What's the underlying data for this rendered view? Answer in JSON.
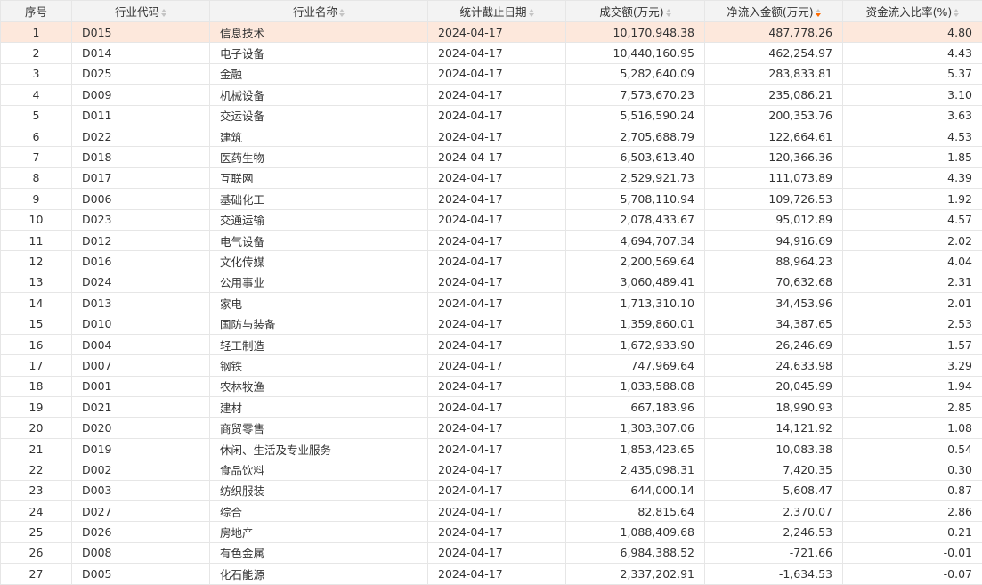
{
  "table": {
    "headers": [
      "序号",
      "行业代码",
      "行业名称",
      "统计截止日期",
      "成交额(万元)",
      "净流入金额(万元)",
      "资金流入比率(%)"
    ],
    "sort_active_color": "#ff6a00",
    "highlight_row_color": "#fde8dc",
    "rows": [
      [
        "1",
        "D015",
        "信息技术",
        "2024-04-17",
        "10,170,948.38",
        "487,778.26",
        "4.80"
      ],
      [
        "2",
        "D014",
        "电子设备",
        "2024-04-17",
        "10,440,160.95",
        "462,254.97",
        "4.43"
      ],
      [
        "3",
        "D025",
        "金融",
        "2024-04-17",
        "5,282,640.09",
        "283,833.81",
        "5.37"
      ],
      [
        "4",
        "D009",
        "机械设备",
        "2024-04-17",
        "7,573,670.23",
        "235,086.21",
        "3.10"
      ],
      [
        "5",
        "D011",
        "交运设备",
        "2024-04-17",
        "5,516,590.24",
        "200,353.76",
        "3.63"
      ],
      [
        "6",
        "D022",
        "建筑",
        "2024-04-17",
        "2,705,688.79",
        "122,664.61",
        "4.53"
      ],
      [
        "7",
        "D018",
        "医药生物",
        "2024-04-17",
        "6,503,613.40",
        "120,366.36",
        "1.85"
      ],
      [
        "8",
        "D017",
        "互联网",
        "2024-04-17",
        "2,529,921.73",
        "111,073.89",
        "4.39"
      ],
      [
        "9",
        "D006",
        "基础化工",
        "2024-04-17",
        "5,708,110.94",
        "109,726.53",
        "1.92"
      ],
      [
        "10",
        "D023",
        "交通运输",
        "2024-04-17",
        "2,078,433.67",
        "95,012.89",
        "4.57"
      ],
      [
        "11",
        "D012",
        "电气设备",
        "2024-04-17",
        "4,694,707.34",
        "94,916.69",
        "2.02"
      ],
      [
        "12",
        "D016",
        "文化传媒",
        "2024-04-17",
        "2,200,569.64",
        "88,964.23",
        "4.04"
      ],
      [
        "13",
        "D024",
        "公用事业",
        "2024-04-17",
        "3,060,489.41",
        "70,632.68",
        "2.31"
      ],
      [
        "14",
        "D013",
        "家电",
        "2024-04-17",
        "1,713,310.10",
        "34,453.96",
        "2.01"
      ],
      [
        "15",
        "D010",
        "国防与装备",
        "2024-04-17",
        "1,359,860.01",
        "34,387.65",
        "2.53"
      ],
      [
        "16",
        "D004",
        "轻工制造",
        "2024-04-17",
        "1,672,933.90",
        "26,246.69",
        "1.57"
      ],
      [
        "17",
        "D007",
        "钢铁",
        "2024-04-17",
        "747,969.64",
        "24,633.98",
        "3.29"
      ],
      [
        "18",
        "D001",
        "农林牧渔",
        "2024-04-17",
        "1,033,588.08",
        "20,045.99",
        "1.94"
      ],
      [
        "19",
        "D021",
        "建材",
        "2024-04-17",
        "667,183.96",
        "18,990.93",
        "2.85"
      ],
      [
        "20",
        "D020",
        "商贸零售",
        "2024-04-17",
        "1,303,307.06",
        "14,121.92",
        "1.08"
      ],
      [
        "21",
        "D019",
        "休闲、生活及专业服务",
        "2024-04-17",
        "1,853,423.65",
        "10,083.38",
        "0.54"
      ],
      [
        "22",
        "D002",
        "食品饮料",
        "2024-04-17",
        "2,435,098.31",
        "7,420.35",
        "0.30"
      ],
      [
        "23",
        "D003",
        "纺织服装",
        "2024-04-17",
        "644,000.14",
        "5,608.47",
        "0.87"
      ],
      [
        "24",
        "D027",
        "综合",
        "2024-04-17",
        "82,815.64",
        "2,370.07",
        "2.86"
      ],
      [
        "25",
        "D026",
        "房地产",
        "2024-04-17",
        "1,088,409.68",
        "2,246.53",
        "0.21"
      ],
      [
        "26",
        "D008",
        "有色金属",
        "2024-04-17",
        "6,984,388.52",
        "-721.66",
        "-0.01"
      ],
      [
        "27",
        "D005",
        "化石能源",
        "2024-04-17",
        "2,337,202.91",
        "-1,634.53",
        "-0.07"
      ]
    ]
  }
}
